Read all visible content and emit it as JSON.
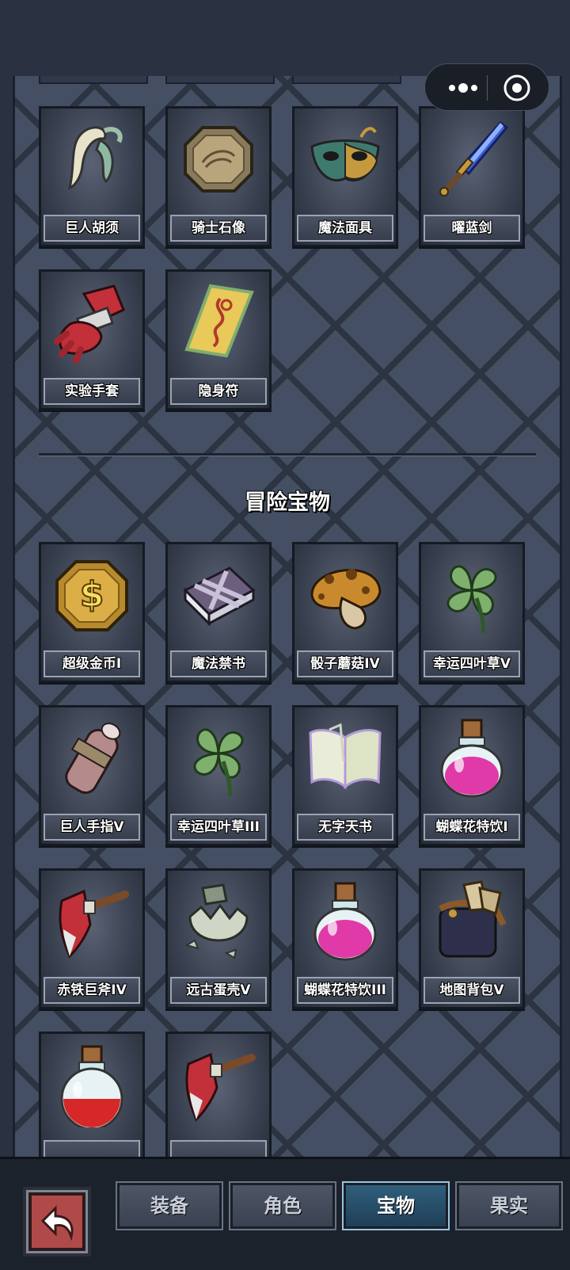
{
  "section_title": "冒险宝物",
  "top_items": [
    {
      "label": "巨人胡须",
      "icon": "tusk-icon"
    },
    {
      "label": "骑士石像",
      "icon": "stone-tablet-icon"
    },
    {
      "label": "魔法面具",
      "icon": "mask-icon"
    },
    {
      "label": "曜蓝剑",
      "icon": "blue-sword-icon"
    },
    {
      "label": "实验手套",
      "icon": "red-glove-icon"
    },
    {
      "label": "隐身符",
      "icon": "talisman-icon"
    }
  ],
  "adventure_items": [
    {
      "label": "超级金币I",
      "icon": "gold-coin-icon"
    },
    {
      "label": "魔法禁书",
      "icon": "chained-book-icon"
    },
    {
      "label": "骰子蘑菇IV",
      "icon": "dice-mushroom-icon"
    },
    {
      "label": "幸运四叶草V",
      "icon": "four-leaf-clover-icon"
    },
    {
      "label": "巨人手指V",
      "icon": "giant-finger-icon"
    },
    {
      "label": "幸运四叶草III",
      "icon": "four-leaf-clover-icon"
    },
    {
      "label": "无字天书",
      "icon": "open-book-icon"
    },
    {
      "label": "蝴蝶花特饮I",
      "icon": "pink-potion-icon"
    },
    {
      "label": "赤铁巨斧IV",
      "icon": "red-axe-icon"
    },
    {
      "label": "远古蛋壳V",
      "icon": "egg-shell-icon"
    },
    {
      "label": "蝴蝶花特饮III",
      "icon": "pink-potion-icon"
    },
    {
      "label": "地图背包V",
      "icon": "map-bag-icon"
    },
    {
      "label": "",
      "icon": "red-potion-icon"
    },
    {
      "label": "",
      "icon": "red-axe-icon"
    }
  ],
  "tabs": [
    {
      "label": "装备"
    },
    {
      "label": "角色"
    },
    {
      "label": "宝物"
    },
    {
      "label": "果实"
    }
  ],
  "active_tab": "宝物",
  "colors": {
    "panel": "#454f63",
    "active_tab": "#2f5f7c",
    "back_button": "#b04a48"
  }
}
